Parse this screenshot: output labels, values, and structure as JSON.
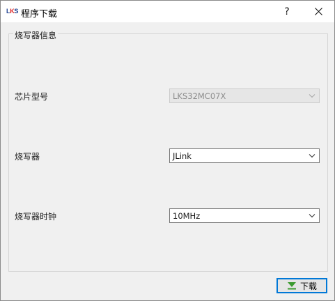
{
  "window": {
    "logo_text": [
      "L",
      "K",
      "S"
    ],
    "title": "程序下载",
    "help_label": "?"
  },
  "group": {
    "title": "烧写器信息"
  },
  "fields": {
    "chip_label": "芯片型号",
    "chip_value": "LKS32MC07X",
    "programmer_label": "烧写器",
    "programmer_value": "JLink",
    "clock_label": "烧写器时钟",
    "clock_value": "10MHz"
  },
  "actions": {
    "download_label": "下载"
  },
  "colors": {
    "accent": "#0078d7",
    "logo_blue": "#1c3f8f",
    "logo_red": "#d22222",
    "download_icon": "#3a9a2f"
  },
  "icons": {
    "logo": "lks-logo",
    "help": "help-icon",
    "close": "close-icon",
    "dropdown": "chevron-down-icon",
    "download": "download-arrow-icon"
  }
}
